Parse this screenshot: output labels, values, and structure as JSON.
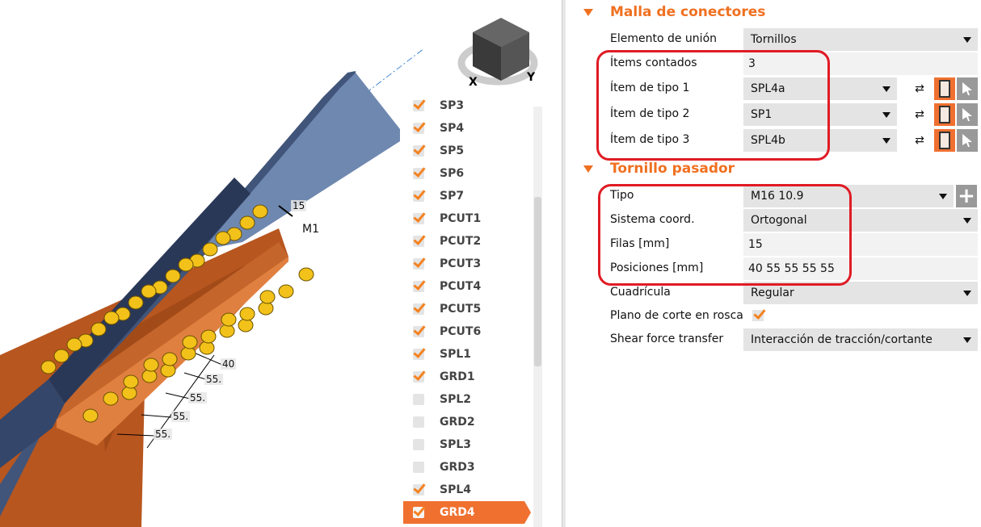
{
  "viewport": {
    "dimensions": {
      "d15": "15",
      "m1": "M1",
      "d40": "40",
      "d55a": "55.",
      "d55b": "55.",
      "d55c": "55.",
      "d55d": "55."
    },
    "colors": {
      "plate": "#b8561f",
      "beam": "#5b7aa8",
      "bolt": "#f2c21a"
    }
  },
  "members": [
    {
      "label": "SP3",
      "checked": true
    },
    {
      "label": "SP4",
      "checked": true
    },
    {
      "label": "SP5",
      "checked": true
    },
    {
      "label": "SP6",
      "checked": true
    },
    {
      "label": "SP7",
      "checked": true
    },
    {
      "label": "PCUT1",
      "checked": true
    },
    {
      "label": "PCUT2",
      "checked": true
    },
    {
      "label": "PCUT3",
      "checked": true
    },
    {
      "label": "PCUT4",
      "checked": true
    },
    {
      "label": "PCUT5",
      "checked": true
    },
    {
      "label": "PCUT6",
      "checked": true
    },
    {
      "label": "SPL1",
      "checked": true
    },
    {
      "label": "GRD1",
      "checked": true
    },
    {
      "label": "SPL2",
      "checked": false
    },
    {
      "label": "GRD2",
      "checked": false
    },
    {
      "label": "SPL3",
      "checked": false
    },
    {
      "label": "GRD3",
      "checked": false
    },
    {
      "label": "SPL4",
      "checked": true
    },
    {
      "label": "GRD4",
      "checked": true,
      "selected": true
    }
  ],
  "panel": {
    "malla": {
      "title": "Malla de conectores",
      "elemento_label": "Elemento de unión",
      "elemento_value": "Tornillos",
      "items_label": "Ítems contados",
      "items_value": "3",
      "tipo1_label": "Ítem de tipo 1",
      "tipo1_value": "SPL4a",
      "tipo2_label": "Ítem de tipo 2",
      "tipo2_value": "SP1",
      "tipo3_label": "Ítem de tipo 3",
      "tipo3_value": "SPL4b"
    },
    "tornillo": {
      "title": "Tornillo pasador",
      "tipo_label": "Tipo",
      "tipo_value": "M16 10.9",
      "sistema_label": "Sistema coord.",
      "sistema_value": "Ortogonal",
      "filas_label": "Filas [mm]",
      "filas_value": "15",
      "pos_label": "Posiciones [mm]",
      "pos_value": "40 55 55 55 55",
      "cuad_label": "Cuadrícula",
      "cuad_value": "Regular",
      "plano_label": "Plano de corte en rosca",
      "plano_checked": true,
      "shear_label": "Shear force transfer",
      "shear_value": "Interacción de tracción/cortante"
    },
    "accent": "#f07020",
    "highlight": "#e01b24"
  }
}
